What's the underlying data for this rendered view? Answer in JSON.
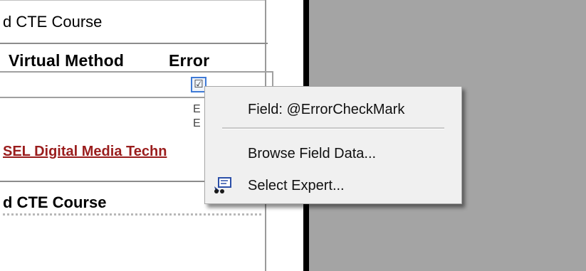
{
  "report": {
    "section_title_top": "d CTE Course",
    "columns": {
      "virtual_method": "Virtual Method",
      "error": "Error"
    },
    "row_letters": [
      "E",
      "E"
    ],
    "link_text": "SEL Digital Media Techn",
    "section_title_bottom": "d CTE Course"
  },
  "context_menu": {
    "field_label": "Field: @ErrorCheckMark",
    "items": [
      {
        "label": "Browse Field Data...",
        "icon": ""
      },
      {
        "label": "Select Expert...",
        "icon": "select-expert-icon"
      }
    ]
  },
  "colors": {
    "link": "#9a1d1d",
    "design_pane_background": "#a4a4a4",
    "menu_background": "#f0f0f0",
    "selection_border": "#3e7ad6"
  }
}
